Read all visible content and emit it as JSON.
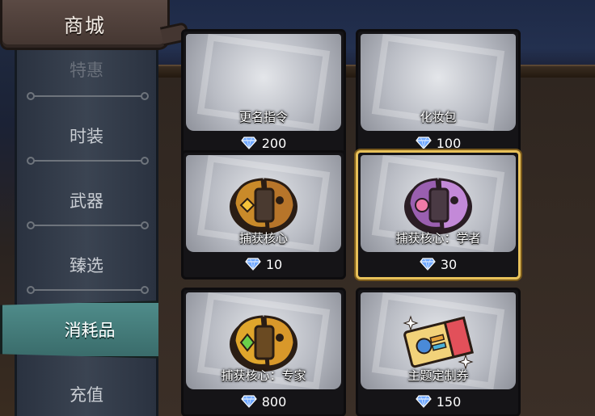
{
  "header": {
    "title": "商城"
  },
  "sidebar": {
    "items": [
      {
        "label": "特惠",
        "state": "partially-hidden"
      },
      {
        "label": "时装"
      },
      {
        "label": "武器"
      },
      {
        "label": "臻选"
      },
      {
        "label": "消耗品",
        "active": true
      },
      {
        "label": "充值"
      }
    ]
  },
  "currency_icon": "diamond-icon",
  "colors": {
    "active_tab": "#4f8c8a",
    "selected_border": "#e8c15a",
    "diamond": "#6fa8ff"
  },
  "shop": {
    "items": [
      {
        "name": "更名指令",
        "price": "200"
      },
      {
        "name": "化妆包",
        "price": "100"
      },
      {
        "name": "捕获核心",
        "price": "10",
        "icon": "capture-core-icon",
        "variant": "orange"
      },
      {
        "name": "捕获核心：学者",
        "price": "30",
        "icon": "capture-core-icon",
        "variant": "purple",
        "selected": true
      },
      {
        "name": "捕获核心：专家",
        "price": "800",
        "icon": "capture-core-icon",
        "variant": "gold"
      },
      {
        "name": "主题定制券",
        "price": "150",
        "icon": "ticket-icon"
      }
    ]
  }
}
